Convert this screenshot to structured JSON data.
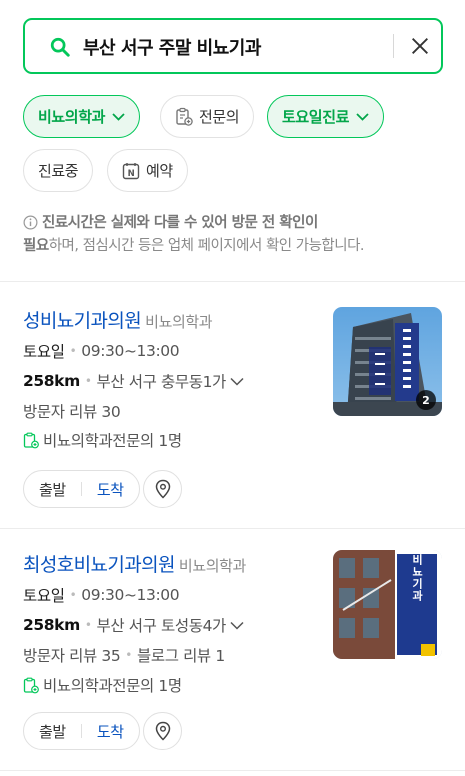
{
  "search": {
    "query": "부산 서구 주말 비뇨기과"
  },
  "filters": {
    "specialty": "비뇨의학과",
    "specialist": "전문의",
    "day": "토요일진료",
    "open_now": "진료중",
    "reservation": "예약"
  },
  "notice": {
    "bold_line": "진료시간은 실제와 다를 수 있어 방문 전 확인이",
    "bold_tail": "필요",
    "rest": "하며, 점심시간 등은 업체 페이지에서 확인 가능합니다."
  },
  "results": [
    {
      "name": "성비뇨기과의원",
      "category": "비뇨의학과",
      "day": "토요일",
      "hours": "09:30~13:00",
      "distance": "258km",
      "address": "부산 서구 충무동1가",
      "reviews": "방문자 리뷰 30",
      "specialists": "비뇨의학과전문의 1명",
      "photo_count": "2",
      "depart_label": "출발",
      "arrive_label": "도착"
    },
    {
      "name": "최성호비뇨기과의원",
      "category": "비뇨의학과",
      "day": "토요일",
      "hours": "09:30~13:00",
      "distance": "258km",
      "address": "부산 서구 토성동4가",
      "reviews": "방문자 리뷰 35",
      "blog_reviews": "블로그 리뷰 1",
      "specialists": "비뇨의학과전문의 1명",
      "sign_text": "최성호비뇨기과",
      "depart_label": "출발",
      "arrive_label": "도착"
    }
  ],
  "colors": {
    "brand_green": "#03c75a",
    "link_blue": "#0a53be"
  }
}
